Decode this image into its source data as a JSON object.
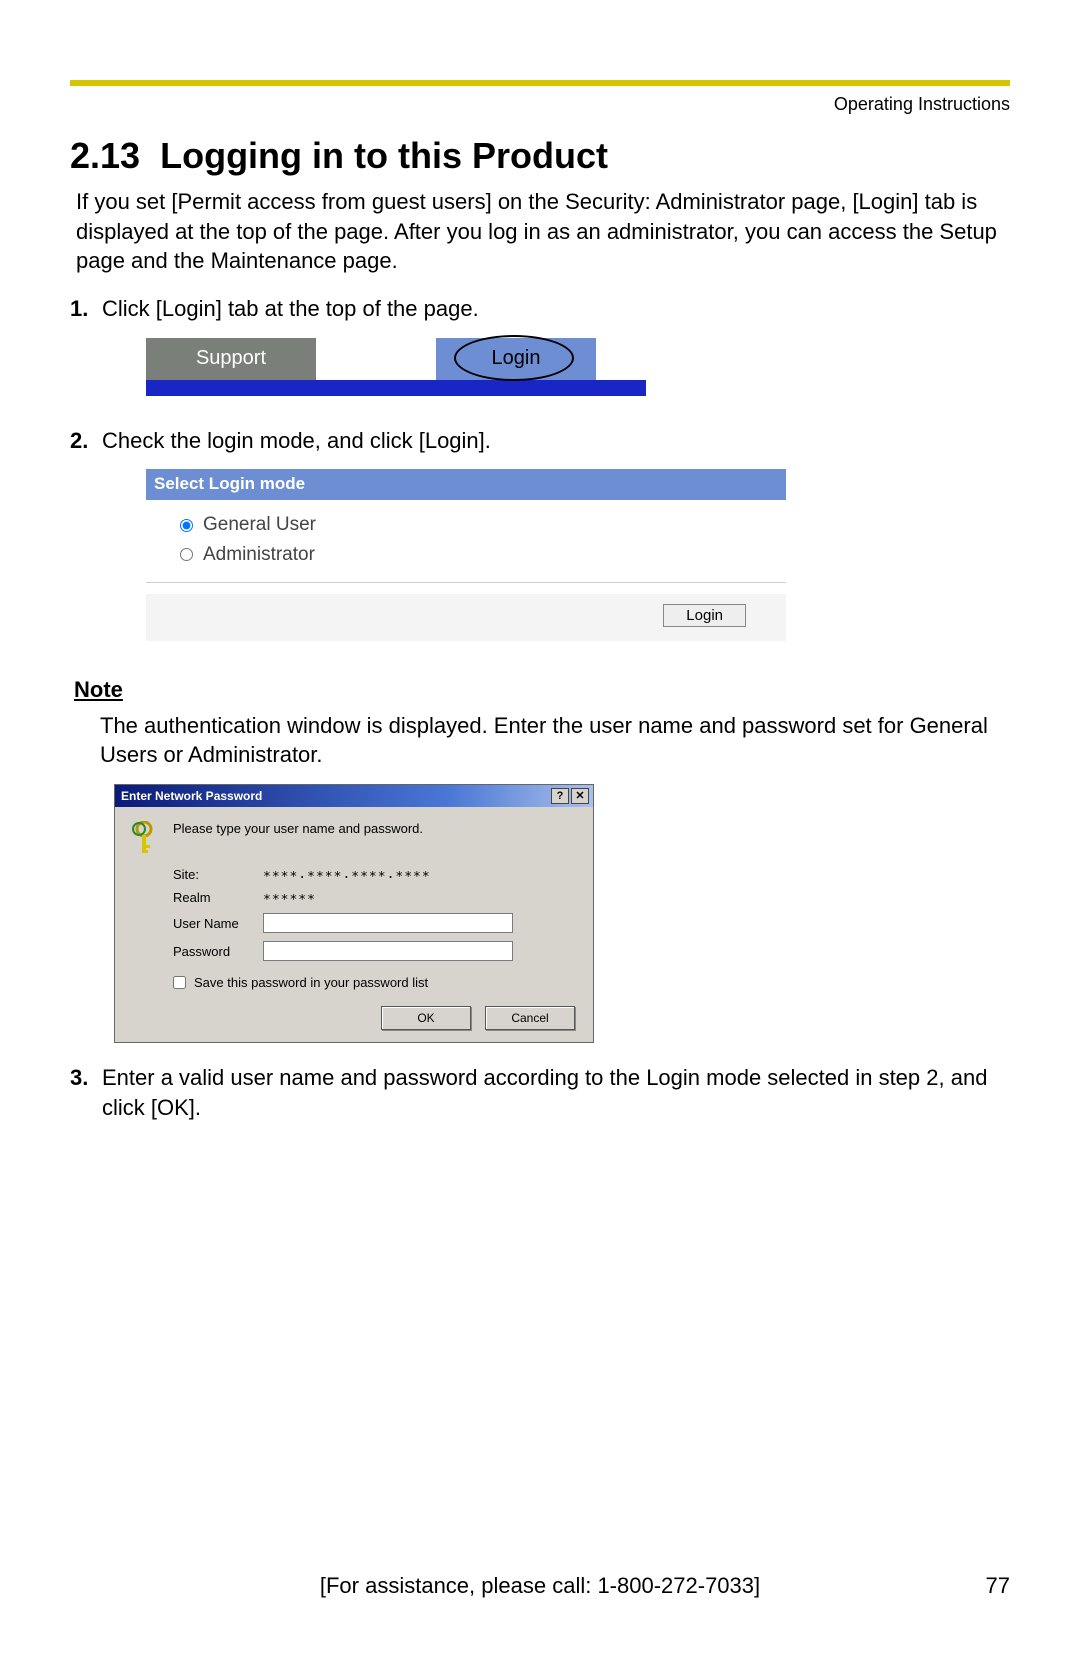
{
  "header": {
    "right_text": "Operating Instructions"
  },
  "section": {
    "number": "2.13",
    "title": "Logging in to this Product",
    "intro": "If you set [Permit access from guest users] on the Security: Administrator page, [Login] tab is displayed at the top of the page. After you log in as an administrator, you can access the Setup page and the Maintenance page."
  },
  "steps": {
    "s1": {
      "num": "1.",
      "text": "Click [Login] tab at the top of the page."
    },
    "s2": {
      "num": "2.",
      "text": "Check the login mode, and click [Login]."
    },
    "s3": {
      "num": "3.",
      "text": "Enter a valid user name and password according to the Login mode selected in step 2, and click [OK]."
    }
  },
  "fig1": {
    "support_tab": "Support",
    "login_tab": "Login"
  },
  "fig2": {
    "title": "Select Login mode",
    "option_general": "General User",
    "option_admin": "Administrator",
    "login_button": "Login"
  },
  "note": {
    "heading": "Note",
    "text": "The authentication window is displayed. Enter the user name and password set for General Users or Administrator."
  },
  "fig3": {
    "title": "Enter Network Password",
    "help_btn": "?",
    "close_btn": "✕",
    "prompt": "Please type your user name and password.",
    "site_label": "Site:",
    "site_value": "∗∗∗∗.∗∗∗∗.∗∗∗∗.∗∗∗∗",
    "realm_label": "Realm",
    "realm_value": "∗∗∗∗∗∗",
    "user_label": "User Name",
    "pass_label": "Password",
    "save_checkbox": "Save this password in your password list",
    "ok_button": "OK",
    "cancel_button": "Cancel"
  },
  "footer": {
    "assist": "[For assistance, please call: 1-800-272-7033]",
    "page": "77"
  }
}
